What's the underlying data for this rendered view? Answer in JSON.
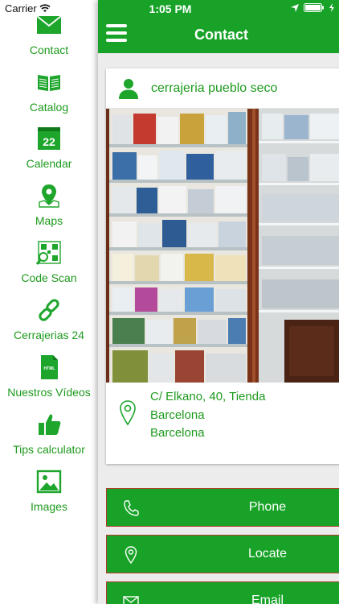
{
  "status_bar": {
    "carrier": "Carrier",
    "time": "1:05 PM"
  },
  "sidebar": {
    "items": [
      {
        "label": "Contact",
        "icon": "envelope-icon"
      },
      {
        "label": "Catalog",
        "icon": "open-book-icon"
      },
      {
        "label": "Calendar",
        "icon": "calendar-icon",
        "day": "22"
      },
      {
        "label": "Maps",
        "icon": "map-pin-icon"
      },
      {
        "label": "Code Scan",
        "icon": "qr-scan-icon"
      },
      {
        "label": "Cerrajerias 24",
        "icon": "chain-link-icon"
      },
      {
        "label": "Nuestros Vídeos",
        "icon": "video-file-icon",
        "badge": "HTML"
      },
      {
        "label": "Tips calculator",
        "icon": "thumbs-up-icon"
      },
      {
        "label": "Images",
        "icon": "image-icon"
      }
    ]
  },
  "header": {
    "title": "Contact"
  },
  "card": {
    "name": "cerrajeria pueblo seco",
    "address": [
      "C/ Elkano, 40, Tienda",
      "Barcelona",
      "Barcelona"
    ]
  },
  "actions": [
    {
      "label": "Phone",
      "icon": "phone-icon"
    },
    {
      "label": "Locate",
      "icon": "location-pin-icon"
    },
    {
      "label": "Email",
      "icon": "email-icon"
    }
  ],
  "colors": {
    "accent": "#18a328",
    "text_green": "#1e9a1e",
    "button_border": "#b23a2a"
  }
}
